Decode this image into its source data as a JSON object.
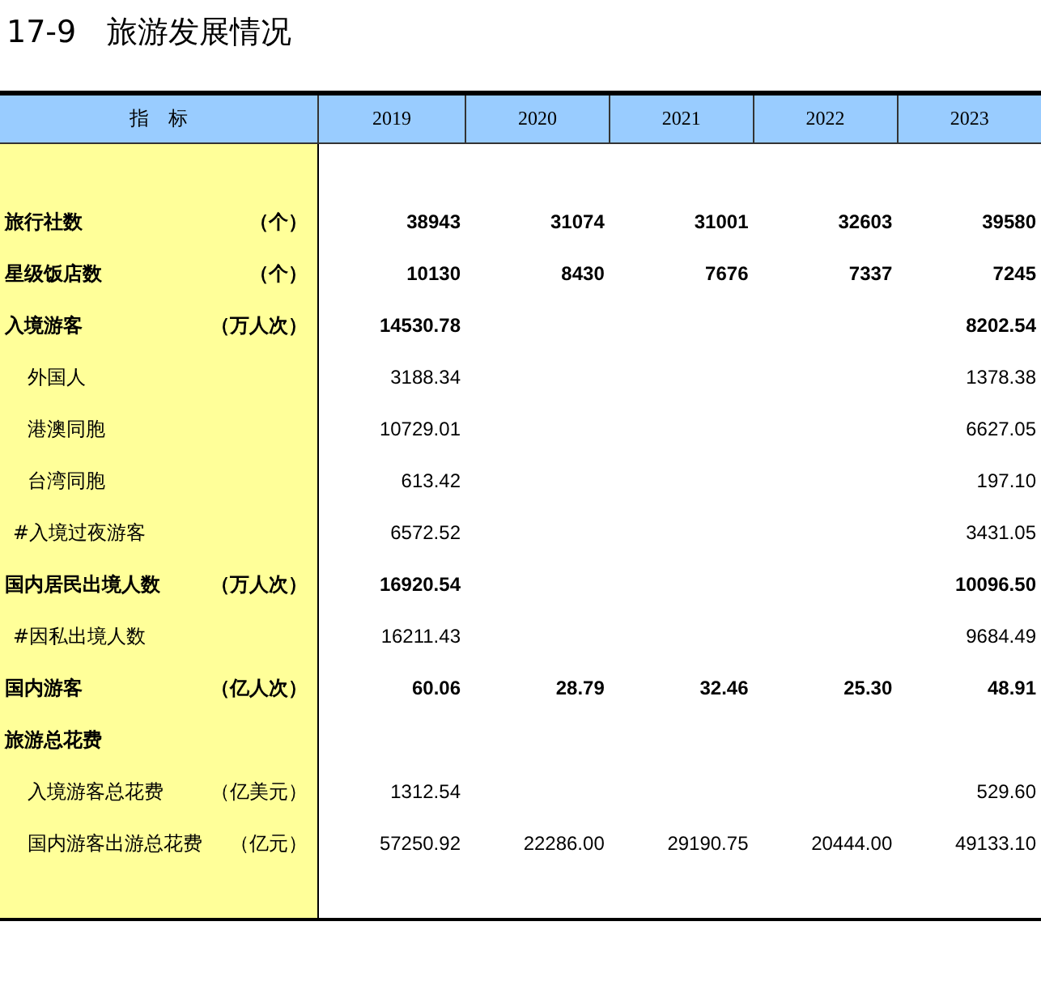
{
  "title": "17-9　旅游发展情况",
  "table": {
    "columns": [
      "指　标",
      "2019",
      "2020",
      "2021",
      "2022",
      "2023"
    ],
    "rows": [
      {
        "kind": "total",
        "label": "旅行社数",
        "unit": "（个）",
        "values": {
          "col_1": "38943",
          "col_2": "31074",
          "col_3": "31001",
          "col_4": "32603",
          "col_5": "39580"
        }
      },
      {
        "kind": "total",
        "label": "星级饭店数",
        "unit": "（个）",
        "values": {
          "col_1": "10130",
          "col_2": "8430",
          "col_3": "7676",
          "col_4": "7337",
          "col_5": "7245"
        }
      },
      {
        "kind": "total",
        "label": "入境游客",
        "unit": "（万人次）",
        "values": {
          "col_1": "14530.78",
          "col_5": "8202.54"
        }
      },
      {
        "kind": "item",
        "label": "外国人",
        "values": {
          "col_1": "3188.34",
          "col_5": "1378.38"
        }
      },
      {
        "kind": "item",
        "label": "港澳同胞",
        "values": {
          "col_1": "10729.01",
          "col_5": "6627.05"
        }
      },
      {
        "kind": "item",
        "label": "台湾同胞",
        "values": {
          "col_1": "613.42",
          "col_5": "197.10"
        }
      },
      {
        "kind": "note",
        "label": "#入境过夜游客",
        "values": {
          "col_1": "6572.52",
          "col_5": "3431.05"
        }
      },
      {
        "kind": "total",
        "label": "国内居民出境人数",
        "unit": "（万人次）",
        "values": {
          "col_1": "16920.54",
          "col_5": "10096.50"
        }
      },
      {
        "kind": "note",
        "label": "#因私出境人数",
        "values": {
          "col_1": "16211.43",
          "col_5": "9684.49"
        }
      },
      {
        "kind": "total",
        "label": "国内游客",
        "unit": "（亿人次）",
        "values": {
          "col_1": "60.06",
          "col_2": "28.79",
          "col_3": "32.46",
          "col_4": "25.30",
          "col_5": "48.91"
        }
      },
      {
        "kind": "total",
        "label": "旅游总花费"
      },
      {
        "kind": "item",
        "label": "入境游客总花费",
        "unit": "（亿美元）",
        "values": {
          "col_1": "1312.54",
          "col_5": "529.60"
        }
      },
      {
        "kind": "item",
        "label": "国内游客出游总花费",
        "unit": "（亿元）",
        "values": {
          "col_1": "57250.92",
          "col_2": "22286.00",
          "col_3": "29190.75",
          "col_4": "20444.00",
          "col_5": "49133.10"
        }
      }
    ]
  }
}
